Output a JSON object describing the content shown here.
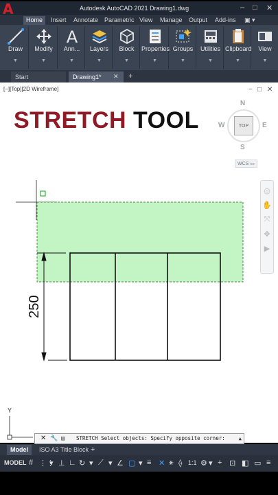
{
  "app": {
    "logo_letter": "A",
    "title": "Autodesk AutoCAD 2021    Drawing1.dwg",
    "window_controls": [
      "–",
      "□",
      "✕"
    ]
  },
  "ribbon_tabs": [
    {
      "label": "Home",
      "active": true
    },
    {
      "label": "Insert",
      "active": false
    },
    {
      "label": "Annotate",
      "active": false
    },
    {
      "label": "Parametric",
      "active": false
    },
    {
      "label": "View",
      "active": false
    },
    {
      "label": "Manage",
      "active": false
    },
    {
      "label": "Output",
      "active": false
    },
    {
      "label": "Add-ins",
      "active": false
    }
  ],
  "ribbon_panels": [
    {
      "label": "Draw",
      "icon": "line-icon"
    },
    {
      "label": "Modify",
      "icon": "move-icon"
    },
    {
      "label": "Ann...",
      "icon": "text-icon"
    },
    {
      "label": "Layers",
      "icon": "layers-icon"
    },
    {
      "label": "Block",
      "icon": "block-icon"
    },
    {
      "label": "Properties",
      "icon": "properties-icon"
    },
    {
      "label": "Groups",
      "icon": "groups-icon"
    },
    {
      "label": "Utilities",
      "icon": "utilities-icon"
    },
    {
      "label": "Clipboard",
      "icon": "clipboard-icon"
    },
    {
      "label": "View",
      "icon": "view-icon"
    }
  ],
  "doc_tabs": {
    "start": "Start",
    "drawing": "Drawing1*",
    "close": "✕",
    "add": "+"
  },
  "viewport": {
    "label": "[−][Top][2D Wireframe]",
    "controls": [
      "−",
      "□",
      "✕"
    ]
  },
  "heading": {
    "word1": "STRETCH",
    "word2": "TOOL"
  },
  "viewcube": {
    "north": "N",
    "south": "S",
    "east": "E",
    "west": "W",
    "face": "TOP",
    "wcs": "WCS ▭"
  },
  "dimension": {
    "value": "250"
  },
  "ucs": {
    "y_label": "Y"
  },
  "command_line": {
    "close": "✕",
    "text": "STRETCH Select objects: Specify opposite corner:",
    "expand": "▲"
  },
  "layout_tabs": {
    "model": "Model",
    "layout1": "ISO A3 Title Block",
    "add": "+"
  },
  "status_bar": {
    "model": "MODEL",
    "scale": "1:1"
  },
  "colors": {
    "accent_red": "#8e1b25",
    "selection_green": "#b9f2b9",
    "ribbon_bg": "#3b4453"
  }
}
